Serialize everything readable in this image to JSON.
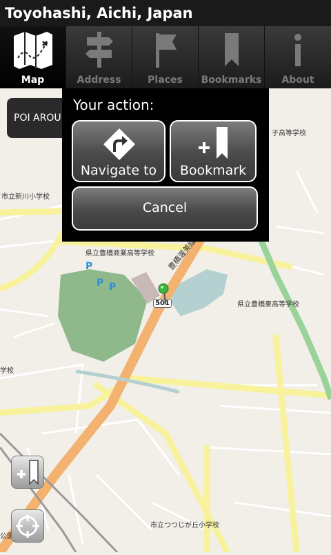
{
  "title": "Toyohashi, Aichi, Japan",
  "tabs": [
    {
      "label": "Map",
      "icon": "map-icon",
      "active": true
    },
    {
      "label": "Address",
      "icon": "signpost-icon"
    },
    {
      "label": "Places",
      "icon": "flag-icon"
    },
    {
      "label": "Bookmarks",
      "icon": "bookmark-icon"
    },
    {
      "label": "About",
      "icon": "info-icon"
    }
  ],
  "poi_button": "POI AROUI",
  "dialog": {
    "heading": "Your action:",
    "navigate": "Navigate to",
    "bookmark": "Bookmark",
    "cancel": "Cancel"
  },
  "map_labels": {
    "school1": "県立豊橋商業高等学校",
    "school2": "県立豊橋東高等学校",
    "school3": "市立新川小学校",
    "school4": "市立つつじが丘小学校",
    "school5": "子高等学校",
    "road": "豊橋渥美線",
    "route": "501",
    "parking": "P",
    "edge1": "学校",
    "edge2": "公園"
  }
}
